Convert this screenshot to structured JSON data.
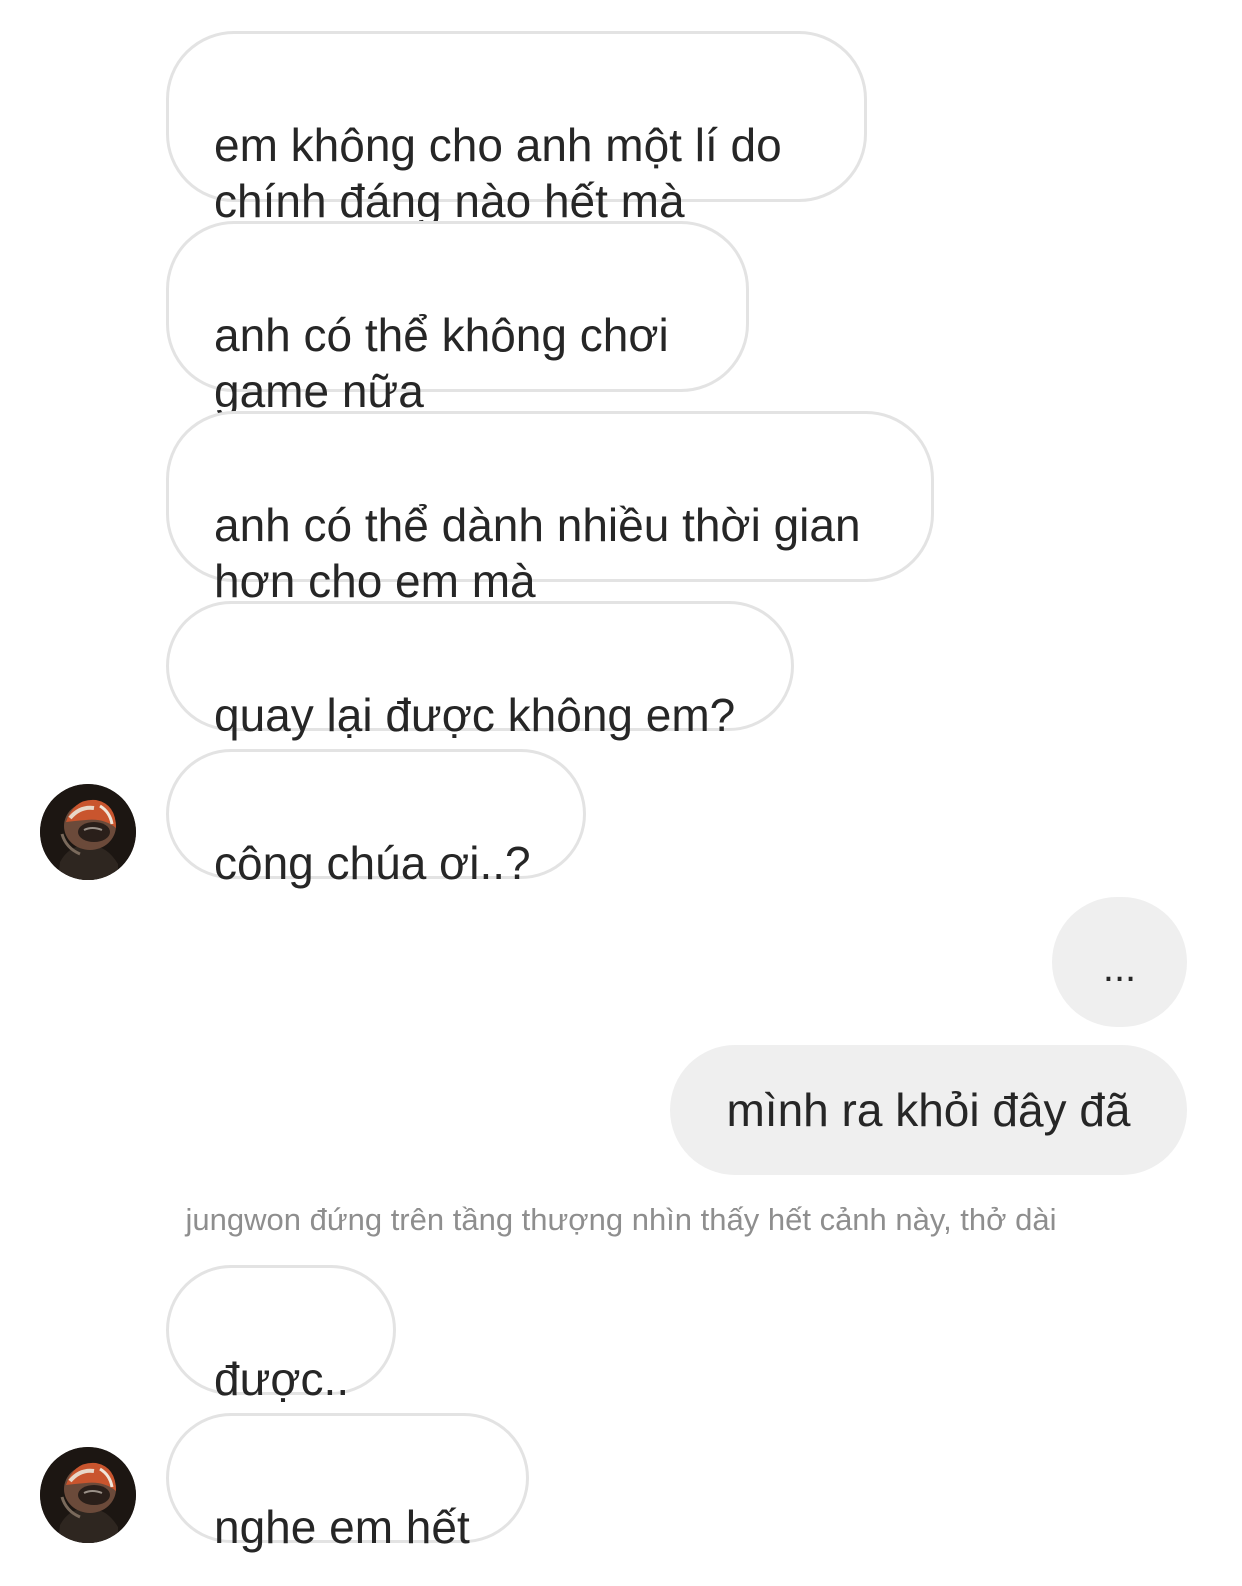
{
  "conversation": {
    "messages": [
      {
        "sender": "other",
        "text": "em không cho anh một lí do\nchính đáng nào hết mà"
      },
      {
        "sender": "other",
        "text": "anh có thể không chơi\ngame nữa"
      },
      {
        "sender": "other",
        "text": "anh có thể dành nhiều thời gian\nhơn cho em mà"
      },
      {
        "sender": "other",
        "text": "quay lại được không em?"
      },
      {
        "sender": "other",
        "text": "công chúa ơi..?"
      },
      {
        "sender": "me",
        "text": "..."
      },
      {
        "sender": "me",
        "text": "mình ra khỏi đây đã"
      },
      {
        "sender": "other",
        "text": "được.."
      },
      {
        "sender": "other",
        "text": "nghe em hết"
      }
    ],
    "system_note": "jungwon đứng trên tầng thượng nhìn thấy hết cảnh này, thở dài",
    "avatar_icon": "helmet-avatar-icon"
  },
  "colors": {
    "incoming_bubble_bg": "#ffffff",
    "incoming_bubble_border": "#e3e3e3",
    "outgoing_bubble_bg": "#efefef",
    "text": "#262626",
    "system_note": "#8e8e8e"
  }
}
